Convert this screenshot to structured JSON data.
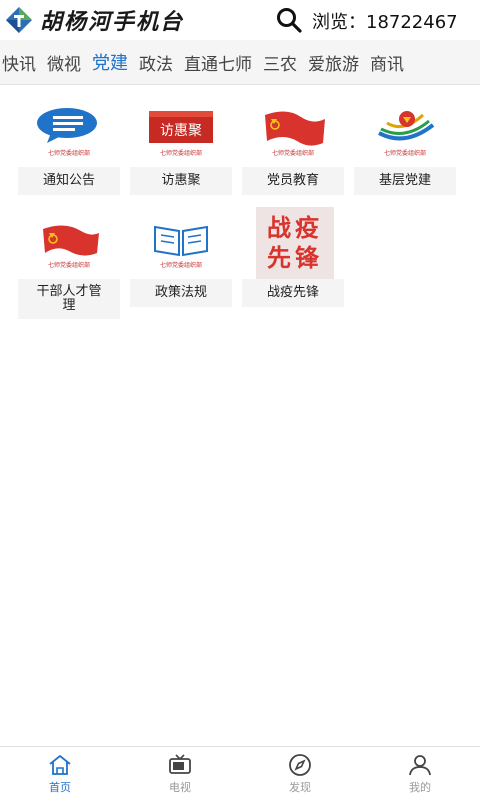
{
  "header": {
    "logo_text": "胡杨河手机台",
    "views_label": "浏览：",
    "views_count": "18722467"
  },
  "tabs": [
    {
      "label": "快讯"
    },
    {
      "label": "微视"
    },
    {
      "label": "党建",
      "active": true
    },
    {
      "label": "政法"
    },
    {
      "label": "直通七师"
    },
    {
      "label": "三农"
    },
    {
      "label": "爱旅游"
    },
    {
      "label": "商讯"
    }
  ],
  "grid": {
    "thumb_caption_text": "七师党委组织部",
    "thumb_banner_text": "访惠聚",
    "zy_line1": "战疫",
    "zy_line2": "先锋",
    "items": [
      {
        "label": "通知公告",
        "icon": "announcement-icon"
      },
      {
        "label": "访惠聚",
        "icon": "banner-icon"
      },
      {
        "label": "党员教育",
        "icon": "party-flag-icon"
      },
      {
        "label": "基层党建",
        "icon": "party-emblem-icon"
      },
      {
        "label": "干部人才管理",
        "icon": "party-flag-icon"
      },
      {
        "label": "政策法规",
        "icon": "book-icon"
      },
      {
        "label": "战疫先锋",
        "icon": "fight-epidemic-icon"
      }
    ]
  },
  "bottom_nav": [
    {
      "label": "首页",
      "icon": "home-icon",
      "active": true
    },
    {
      "label": "电视",
      "icon": "tv-icon"
    },
    {
      "label": "发现",
      "icon": "compass-icon"
    },
    {
      "label": "我的",
      "icon": "user-icon"
    }
  ],
  "colors": {
    "accent": "#1f73c9",
    "party_red": "#d8332c",
    "gold": "#e0a400"
  }
}
